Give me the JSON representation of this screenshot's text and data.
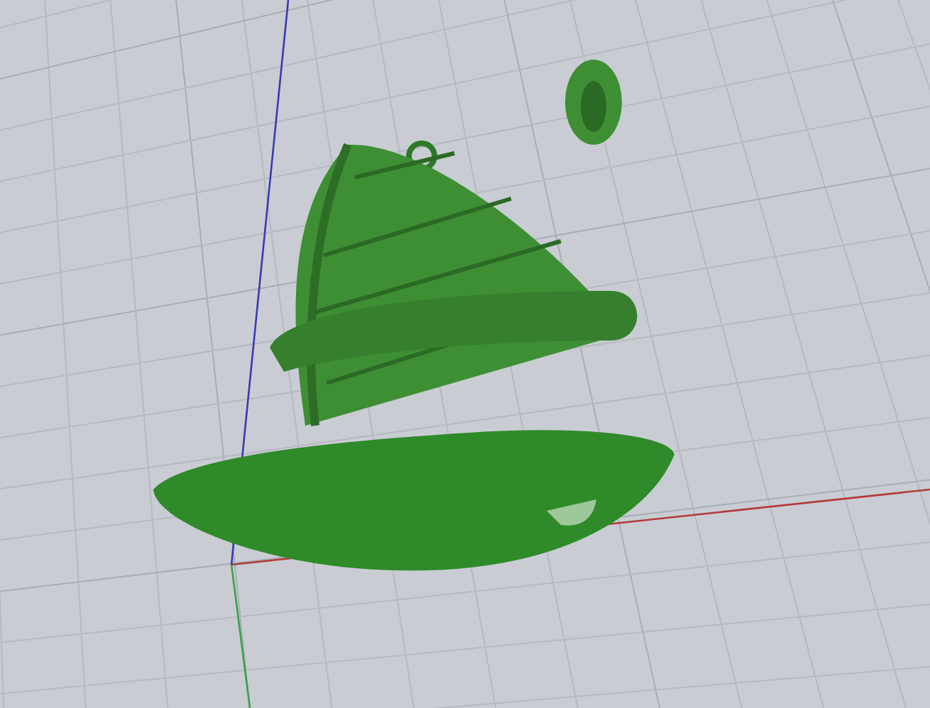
{
  "viewport": {
    "axes": [
      {
        "kind": "x",
        "color": "#b23a3a"
      },
      {
        "kind": "y",
        "color": "#3aa04a"
      },
      {
        "kind": "z",
        "color": "#3a3ab0"
      }
    ]
  }
}
